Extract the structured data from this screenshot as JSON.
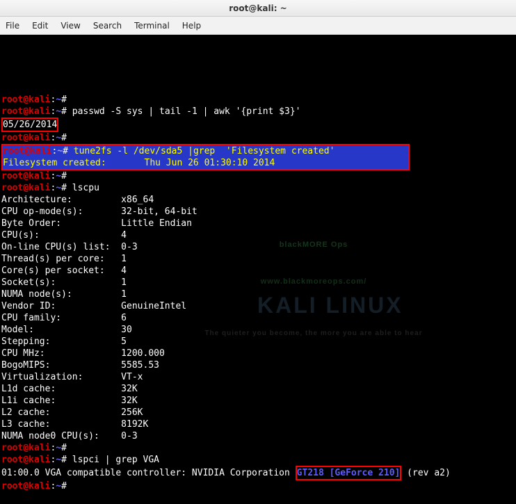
{
  "window": {
    "title": "root@kali: ~"
  },
  "menu": {
    "file": "File",
    "edit": "Edit",
    "view": "View",
    "search": "Search",
    "terminal": "Terminal",
    "help": "Help"
  },
  "prompt": {
    "user": "root",
    "at": "@",
    "host": "kali",
    "sep": ":",
    "path": "~",
    "sym": "#"
  },
  "commands": {
    "c1": " passwd -S sys | tail -1 | awk '{print $3}'",
    "c2": " tune2fs -l /dev/sda5 |grep  'Filesystem created'",
    "c3": " lscpu",
    "c4": " lspci | grep VGA"
  },
  "out": {
    "date": "05/26/2014",
    "fsline": "Filesystem created:       Thu Jun 26 01:30:10 2014                           "
  },
  "lscpu": [
    [
      "Architecture:",
      "x86_64"
    ],
    [
      "CPU op-mode(s):",
      "32-bit, 64-bit"
    ],
    [
      "Byte Order:",
      "Little Endian"
    ],
    [
      "CPU(s):",
      "4"
    ],
    [
      "On-line CPU(s) list:",
      "0-3"
    ],
    [
      "Thread(s) per core:",
      "1"
    ],
    [
      "Core(s) per socket:",
      "4"
    ],
    [
      "Socket(s):",
      "1"
    ],
    [
      "NUMA node(s):",
      "1"
    ],
    [
      "Vendor ID:",
      "GenuineIntel"
    ],
    [
      "CPU family:",
      "6"
    ],
    [
      "Model:",
      "30"
    ],
    [
      "Stepping:",
      "5"
    ],
    [
      "CPU MHz:",
      "1200.000"
    ],
    [
      "BogoMIPS:",
      "5585.53"
    ],
    [
      "Virtualization:",
      "VT-x"
    ],
    [
      "L1d cache:",
      "32K"
    ],
    [
      "L1i cache:",
      "32K"
    ],
    [
      "L2 cache:",
      "256K"
    ],
    [
      "L3 cache:",
      "8192K"
    ],
    [
      "NUMA node0 CPU(s):",
      "0-3"
    ]
  ],
  "lspci": {
    "pre": "01:00.0 VGA compatible controller: NVIDIA Corporation ",
    "gpu": "GT218 [GeForce 210]",
    "post": " (rev a2)"
  },
  "watermark": {
    "small": "blackMORE Ops",
    "url": "www.blackmoreops.com/",
    "main": "KALI LINUX",
    "tag": "The quieter you become, the more you are able to hear"
  }
}
